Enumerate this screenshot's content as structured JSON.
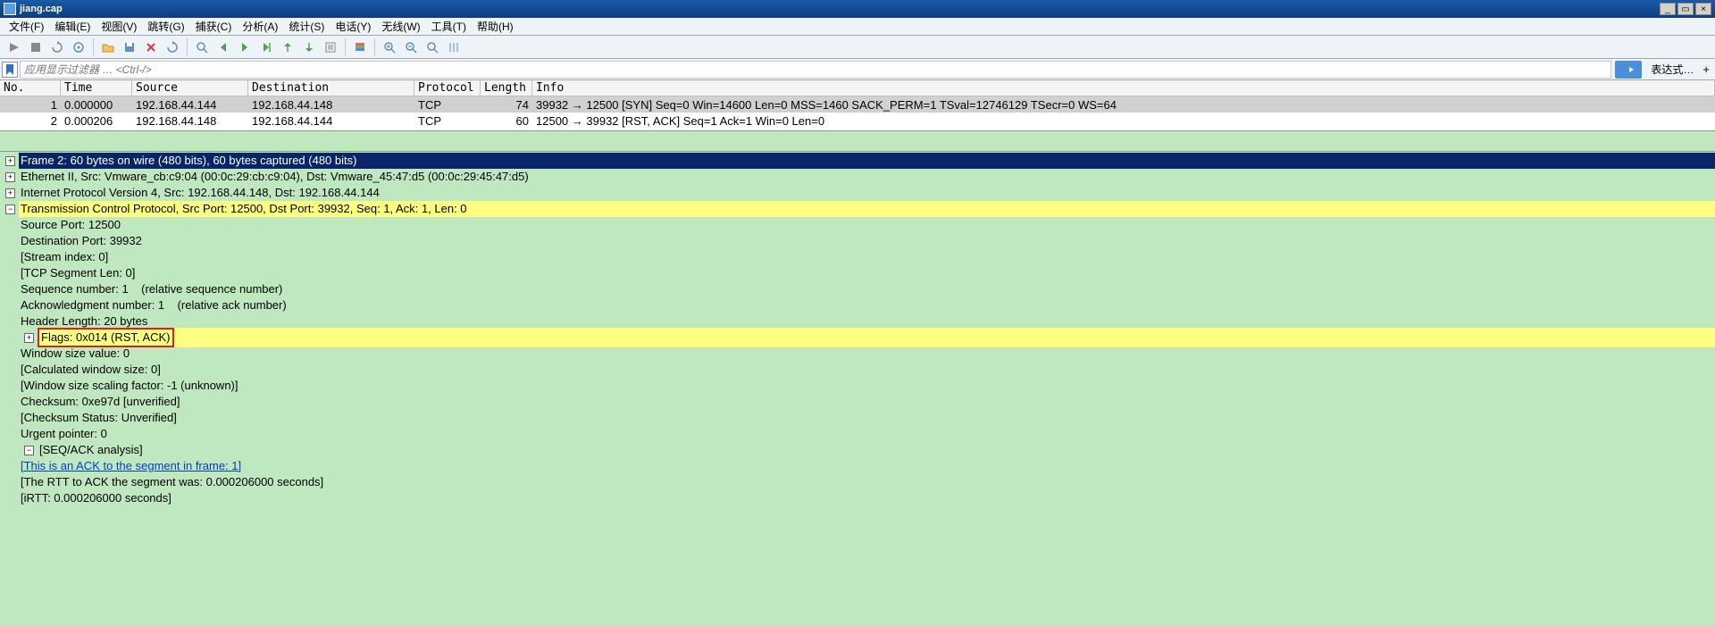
{
  "title": "jiang.cap",
  "menu": [
    "文件(F)",
    "编辑(E)",
    "视图(V)",
    "跳转(G)",
    "捕获(C)",
    "分析(A)",
    "统计(S)",
    "电话(Y)",
    "无线(W)",
    "工具(T)",
    "帮助(H)"
  ],
  "filter_placeholder": "应用显示过滤器 … <Ctrl-/>",
  "expr_label": "表达式…",
  "columns": {
    "no": "No.",
    "time": "Time",
    "src": "Source",
    "dst": "Destination",
    "proto": "Protocol",
    "len": "Length",
    "info": "Info"
  },
  "packets": [
    {
      "no": "1",
      "time": "0.000000",
      "src": "192.168.44.144",
      "dst": "192.168.44.148",
      "proto": "TCP",
      "len": "74",
      "info": "39932 → 12500 [SYN] Seq=0 Win=14600 Len=0 MSS=1460 SACK_PERM=1 TSval=12746129 TSecr=0 WS=64"
    },
    {
      "no": "2",
      "time": "0.000206",
      "src": "192.168.44.148",
      "dst": "192.168.44.144",
      "proto": "TCP",
      "len": "60",
      "info": "12500 → 39932 [RST, ACK] Seq=1 Ack=1 Win=0 Len=0"
    }
  ],
  "details": {
    "frame": "Frame 2: 60 bytes on wire (480 bits), 60 bytes captured (480 bits)",
    "eth": "Ethernet II, Src: Vmware_cb:c9:04 (00:0c:29:cb:c9:04), Dst: Vmware_45:47:d5 (00:0c:29:45:47:d5)",
    "ip": "Internet Protocol Version 4, Src: 192.168.44.148, Dst: 192.168.44.144",
    "tcp": "Transmission Control Protocol, Src Port: 12500, Dst Port: 39932, Seq: 1, Ack: 1, Len: 0",
    "tcp_fields": [
      "Source Port: 12500",
      "Destination Port: 39932",
      "[Stream index: 0]",
      "[TCP Segment Len: 0]",
      "Sequence number: 1    (relative sequence number)",
      "Acknowledgment number: 1    (relative ack number)",
      "Header Length: 20 bytes"
    ],
    "flags": "Flags: 0x014 (RST, ACK)",
    "after_flags": [
      "Window size value: 0",
      "[Calculated window size: 0]",
      "[Window size scaling factor: -1 (unknown)]",
      "Checksum: 0xe97d [unverified]",
      "[Checksum Status: Unverified]",
      "Urgent pointer: 0"
    ],
    "seqack": "[SEQ/ACK analysis]",
    "seqack_link": "[This is an ACK to the segment in frame: 1]",
    "seqack_after": [
      "[The RTT to ACK the segment was: 0.000206000 seconds]",
      "[iRTT: 0.000206000 seconds]"
    ]
  }
}
